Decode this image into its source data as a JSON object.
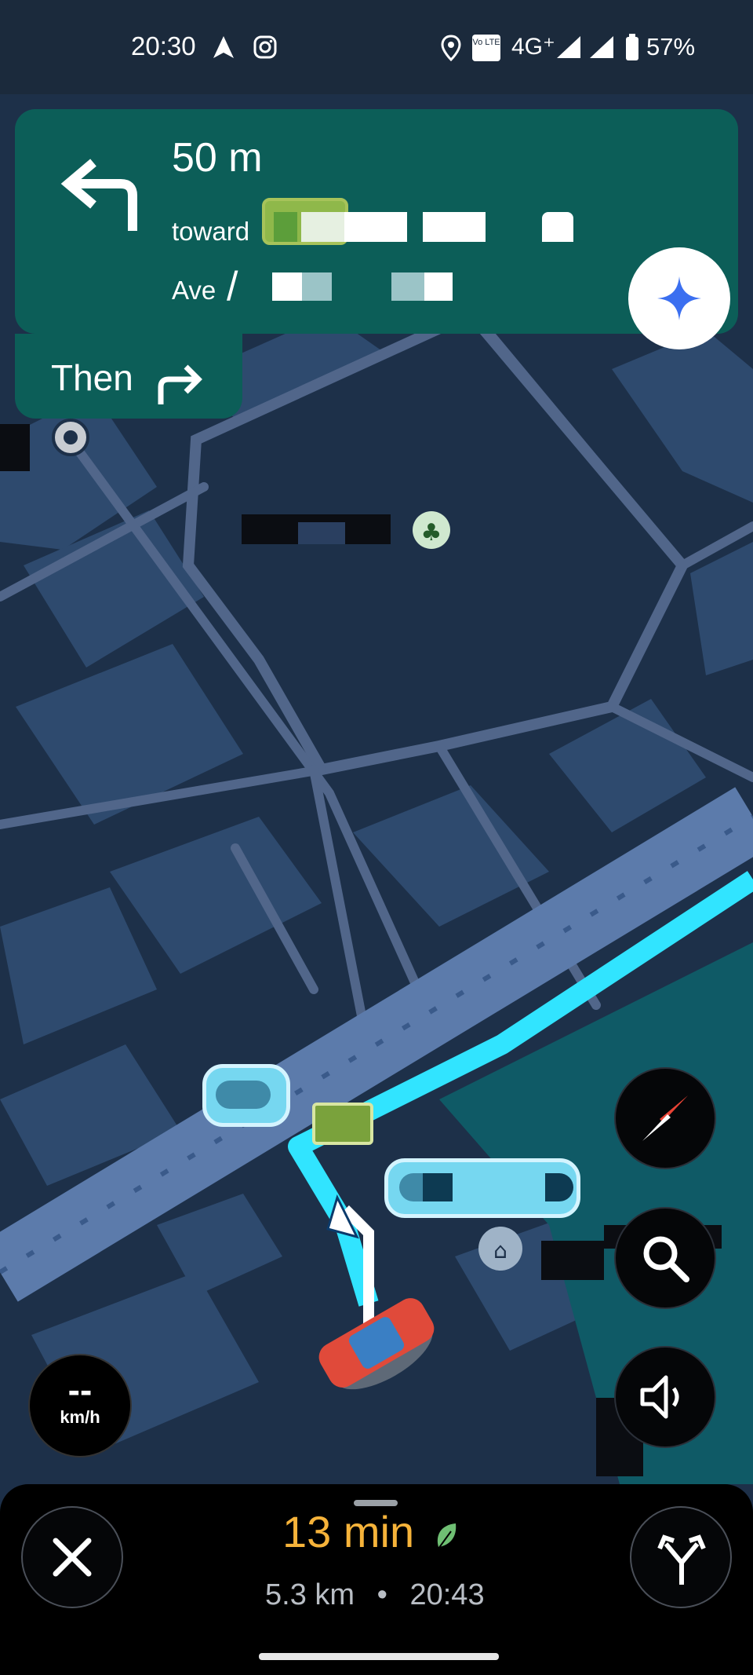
{
  "status_bar": {
    "time": "20:30",
    "network": "4G⁺",
    "volte": "Vo LTE",
    "battery": "57%"
  },
  "navigation": {
    "distance": "50 m",
    "toward_label": "toward",
    "ave_label": "Ave",
    "then_label": "Then"
  },
  "speedometer": {
    "value": "--",
    "unit": "km/h"
  },
  "trip": {
    "duration": "13 min",
    "distance": "5.3 km",
    "separator": "•",
    "eta": "20:43"
  },
  "colors": {
    "map_background": "#1d3049",
    "nav_card": "#0c5e58",
    "route": "#31e4ff",
    "duration_text": "#f6b33a",
    "eco_leaf": "#6fbf73"
  },
  "icons": {
    "maneuver": "turn-left-icon",
    "next_maneuver": "turn-right-icon",
    "assistant": "gemini-icon",
    "compass": "compass-icon",
    "search": "search-icon",
    "sound": "volume-icon",
    "close": "close-icon",
    "alternates": "alternate-routes-icon",
    "eco": "leaf-icon",
    "car": "car-icon",
    "museum": "museum-icon",
    "park": "park-icon"
  }
}
